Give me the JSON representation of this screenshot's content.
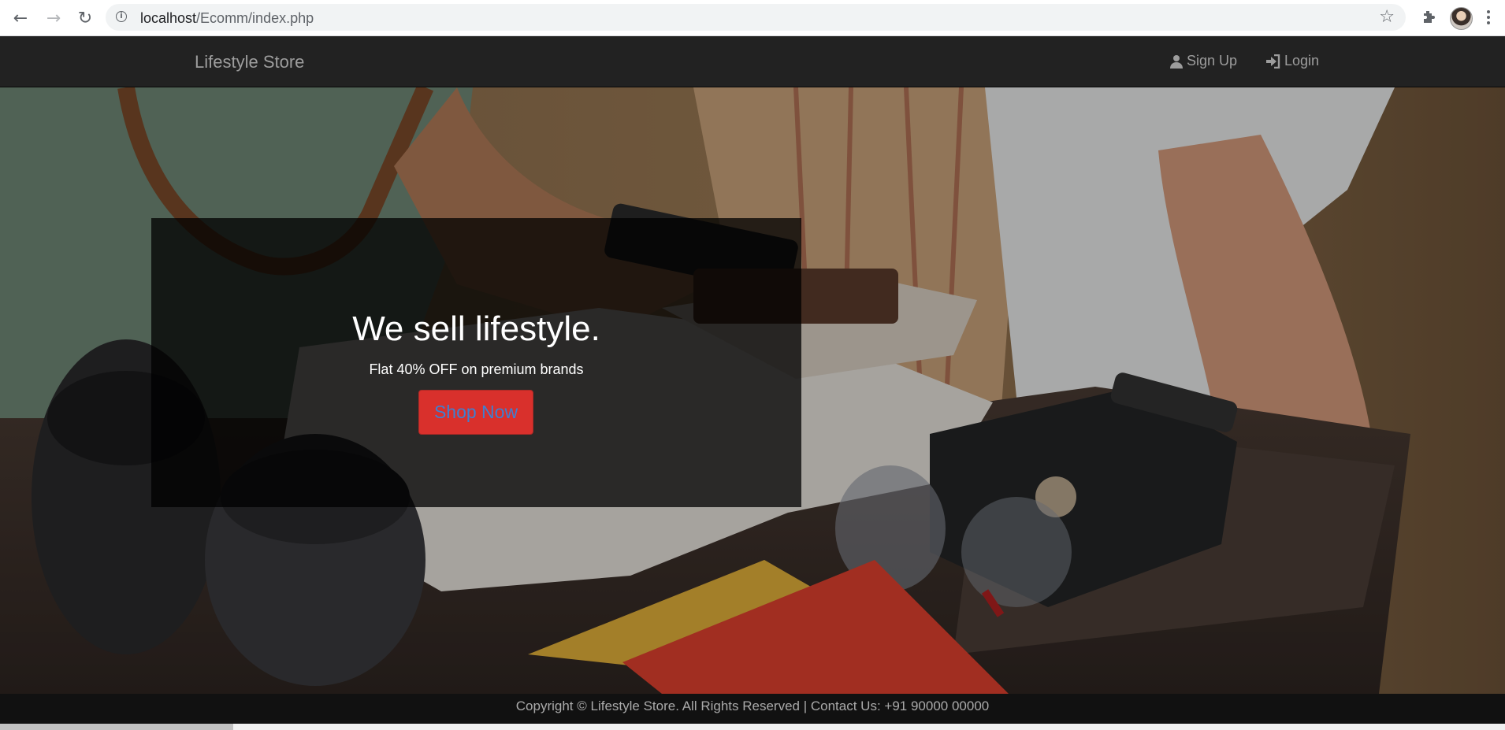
{
  "browser": {
    "url_host": "localhost",
    "url_path": "/Ecomm/index.php",
    "icons": [
      "back-icon",
      "forward-icon",
      "reload-icon",
      "info-icon",
      "star-icon",
      "extensions-icon",
      "profile-avatar",
      "menu-icon"
    ]
  },
  "navbar": {
    "brand": "Lifestyle Store",
    "links": [
      {
        "label": "Sign Up",
        "icon": "user-icon"
      },
      {
        "label": "Login",
        "icon": "login-icon"
      }
    ]
  },
  "hero": {
    "title": "We sell lifestyle.",
    "subtitle": "Flat 40% OFF on premium brands",
    "button_label": "Shop Now"
  },
  "footer": {
    "text": "Copyright © Lifestyle Store. All Rights Reserved | Contact Us: +91 90000 00000"
  },
  "colors": {
    "navbar_bg": "#222222",
    "button_bg": "#d9302c",
    "button_text": "#3f7fd0",
    "footer_bg": "#111111"
  }
}
